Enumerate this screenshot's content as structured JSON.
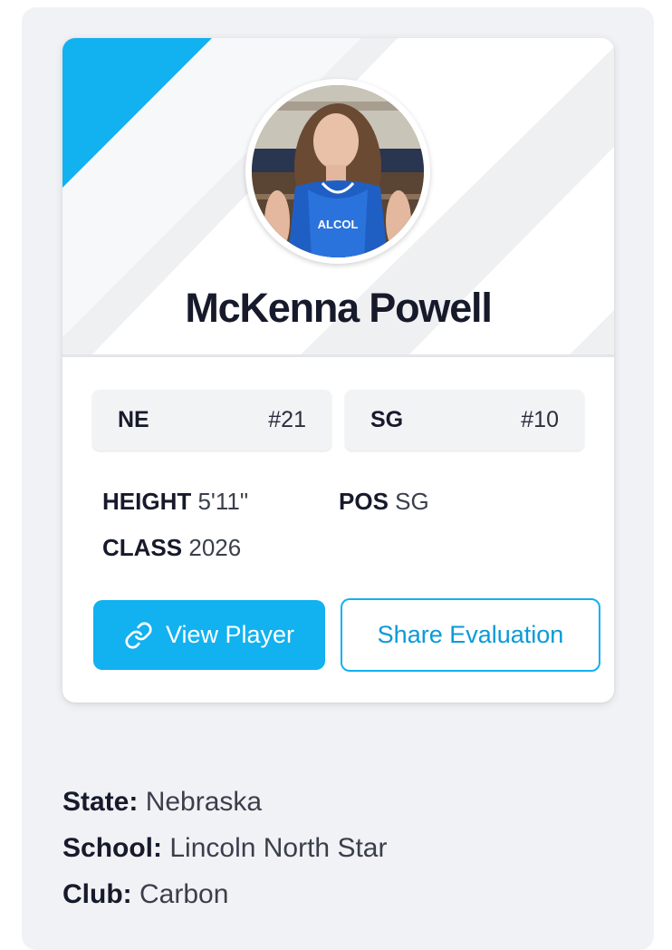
{
  "colors": {
    "accent": "#12b1f0",
    "page_bg": "#f1f2f5",
    "text_dark": "#161a2b"
  },
  "player": {
    "name": "McKenna Powell",
    "photo_alt": "Player photo"
  },
  "rankings": [
    {
      "label": "NE",
      "value": "#21"
    },
    {
      "label": "SG",
      "value": "#10"
    }
  ],
  "attributes": {
    "height": {
      "label": "HEIGHT",
      "value": "5'11\""
    },
    "pos": {
      "label": "POS",
      "value": "SG"
    },
    "class": {
      "label": "CLASS",
      "value": "2026"
    }
  },
  "buttons": {
    "view_player": "View Player",
    "view_player_icon": "link-icon",
    "share_evaluation": "Share Evaluation"
  },
  "details": {
    "state": {
      "label": "State:",
      "value": "Nebraska"
    },
    "school": {
      "label": "School:",
      "value": "Lincoln North Star"
    },
    "club": {
      "label": "Club:",
      "value": "Carbon"
    }
  }
}
